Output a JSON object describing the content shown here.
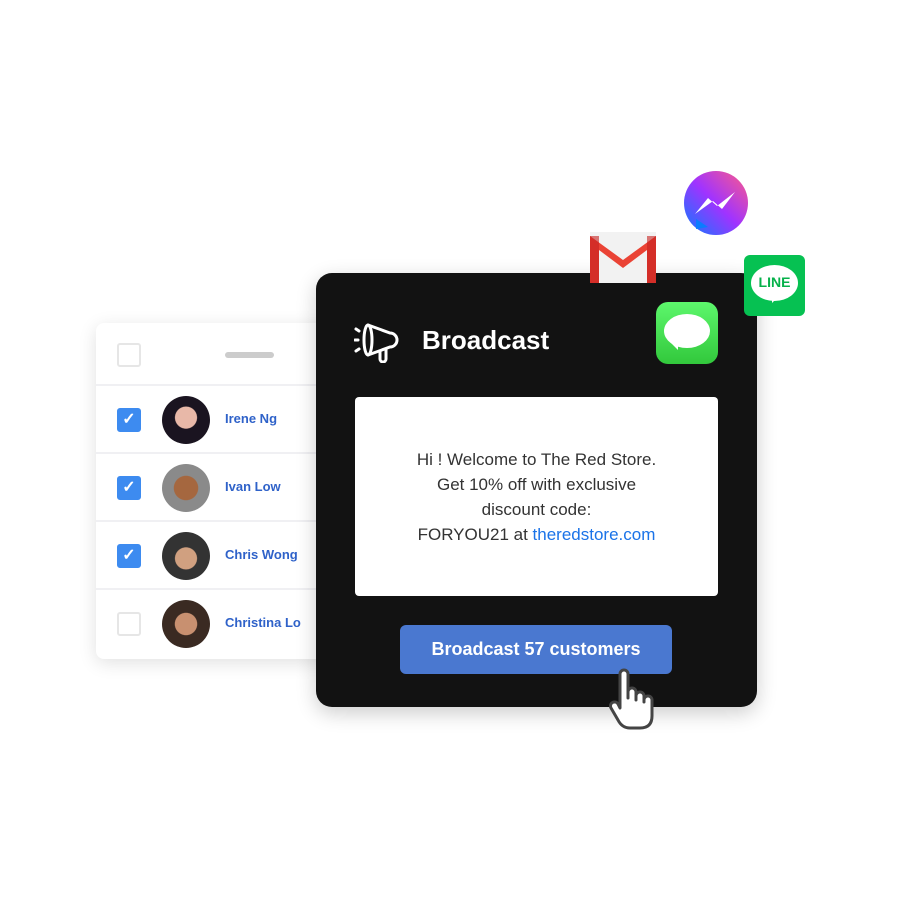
{
  "contacts": {
    "items": [
      {
        "name": "Irene Ng",
        "checked": true
      },
      {
        "name": "Ivan Low",
        "checked": true
      },
      {
        "name": "Chris Wong",
        "checked": true
      },
      {
        "name": "Christina Lo",
        "checked": false
      }
    ]
  },
  "broadcast": {
    "title": "Broadcast",
    "message_line1": "Hi ! Welcome to The Red Store.",
    "message_line2": "Get 10% off with exclusive",
    "message_line3": "discount code:",
    "message_code": "FORYOU21 at ",
    "message_link": "theredstore.com",
    "button_label": "Broadcast 57 customers"
  },
  "apps": {
    "line_label": "LINE"
  },
  "colors": {
    "accent": "#4a78d0",
    "link": "#1a73e8",
    "checkbox": "#3d8bf0",
    "card": "#121212"
  }
}
